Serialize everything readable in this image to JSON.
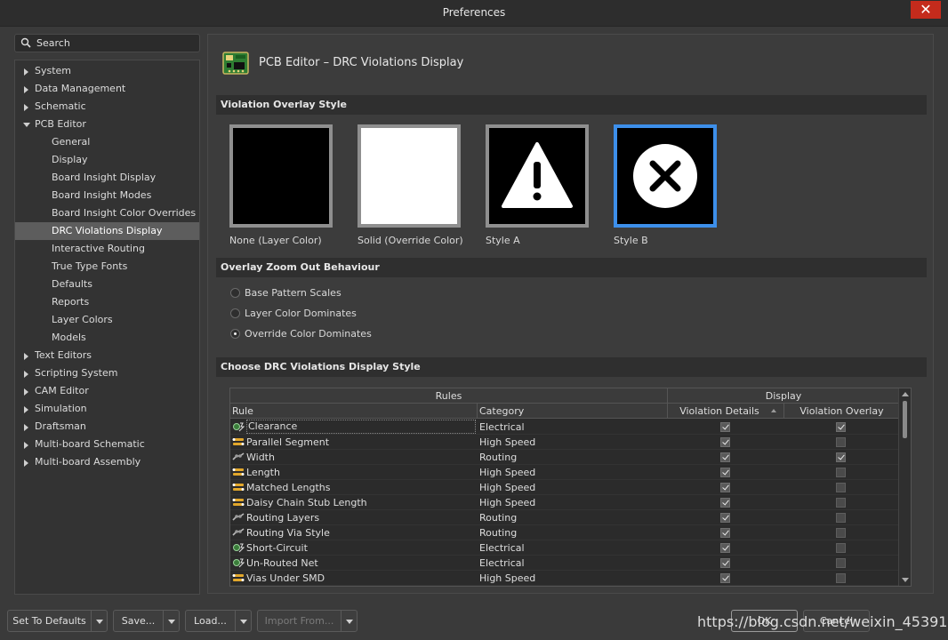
{
  "window": {
    "title": "Preferences",
    "close_label": "✕"
  },
  "search": {
    "label": "Search"
  },
  "tree": [
    {
      "label": "System",
      "level": 0,
      "expanded": false
    },
    {
      "label": "Data Management",
      "level": 0,
      "expanded": false
    },
    {
      "label": "Schematic",
      "level": 0,
      "expanded": false
    },
    {
      "label": "PCB Editor",
      "level": 0,
      "expanded": true
    },
    {
      "label": "General",
      "level": 1
    },
    {
      "label": "Display",
      "level": 1
    },
    {
      "label": "Board Insight Display",
      "level": 1
    },
    {
      "label": "Board Insight Modes",
      "level": 1
    },
    {
      "label": "Board Insight Color Overrides",
      "level": 1
    },
    {
      "label": "DRC Violations Display",
      "level": 1,
      "selected": true
    },
    {
      "label": "Interactive Routing",
      "level": 1
    },
    {
      "label": "True Type Fonts",
      "level": 1
    },
    {
      "label": "Defaults",
      "level": 1
    },
    {
      "label": "Reports",
      "level": 1
    },
    {
      "label": "Layer Colors",
      "level": 1
    },
    {
      "label": "Models",
      "level": 1
    },
    {
      "label": "Text Editors",
      "level": 0,
      "expanded": false
    },
    {
      "label": "Scripting System",
      "level": 0,
      "expanded": false
    },
    {
      "label": "CAM Editor",
      "level": 0,
      "expanded": false
    },
    {
      "label": "Simulation",
      "level": 0,
      "expanded": false
    },
    {
      "label": "Draftsman",
      "level": 0,
      "expanded": false
    },
    {
      "label": "Multi-board Schematic",
      "level": 0,
      "expanded": false
    },
    {
      "label": "Multi-board Assembly",
      "level": 0,
      "expanded": false
    }
  ],
  "page": {
    "title": "PCB Editor – DRC Violations Display"
  },
  "overlay": {
    "heading": "Violation Overlay Style",
    "options": [
      {
        "label": "None (Layer Color)"
      },
      {
        "label": "Solid (Override Color)"
      },
      {
        "label": "Style A"
      },
      {
        "label": "Style B",
        "selected": true
      }
    ]
  },
  "zoom": {
    "heading": "Overlay Zoom Out Behaviour",
    "options": [
      {
        "label": "Base Pattern Scales",
        "checked": false
      },
      {
        "label": "Layer Color Dominates",
        "checked": false
      },
      {
        "label": "Override Color Dominates",
        "checked": true
      }
    ]
  },
  "drc": {
    "heading": "Choose DRC Violations Display Style",
    "group_rules": "Rules",
    "group_display": "Display",
    "col_rule": "Rule",
    "col_category": "Category",
    "col_details": "Violation Details",
    "col_overlay": "Violation Overlay",
    "rows": [
      {
        "rule": "Clearance",
        "category": "Electrical",
        "details": true,
        "overlay": true,
        "icon": "electrical-rule-icon"
      },
      {
        "rule": "Parallel Segment",
        "category": "High Speed",
        "details": true,
        "overlay": false,
        "icon": "highspeed-rule-icon"
      },
      {
        "rule": "Width",
        "category": "Routing",
        "details": true,
        "overlay": true,
        "icon": "routing-rule-icon"
      },
      {
        "rule": "Length",
        "category": "High Speed",
        "details": true,
        "overlay": false,
        "icon": "highspeed-rule-icon"
      },
      {
        "rule": "Matched Lengths",
        "category": "High Speed",
        "details": true,
        "overlay": false,
        "icon": "highspeed-rule-icon"
      },
      {
        "rule": "Daisy Chain Stub Length",
        "category": "High Speed",
        "details": true,
        "overlay": false,
        "icon": "highspeed-rule-icon"
      },
      {
        "rule": "Routing Layers",
        "category": "Routing",
        "details": true,
        "overlay": false,
        "icon": "routing-rule-icon"
      },
      {
        "rule": "Routing Via Style",
        "category": "Routing",
        "details": true,
        "overlay": false,
        "icon": "routing-rule-icon"
      },
      {
        "rule": "Short-Circuit",
        "category": "Electrical",
        "details": true,
        "overlay": false,
        "icon": "electrical-rule-icon"
      },
      {
        "rule": "Un-Routed Net",
        "category": "Electrical",
        "details": true,
        "overlay": false,
        "icon": "electrical-rule-icon"
      },
      {
        "rule": "Vias Under SMD",
        "category": "High Speed",
        "details": true,
        "overlay": false,
        "icon": "highspeed-rule-icon"
      }
    ]
  },
  "buttons": {
    "set_defaults": "Set To Defaults",
    "save": "Save...",
    "load": "Load...",
    "import": "Import From...",
    "ok": "OK",
    "cancel": "Cancel"
  },
  "watermark": "https://blog.csdn.net/weixin_45391118",
  "colors": {
    "accent": "#3d8fea",
    "background": "#3a3a3a",
    "titlebar": "#2d2d2d",
    "close": "#c42b1c"
  }
}
